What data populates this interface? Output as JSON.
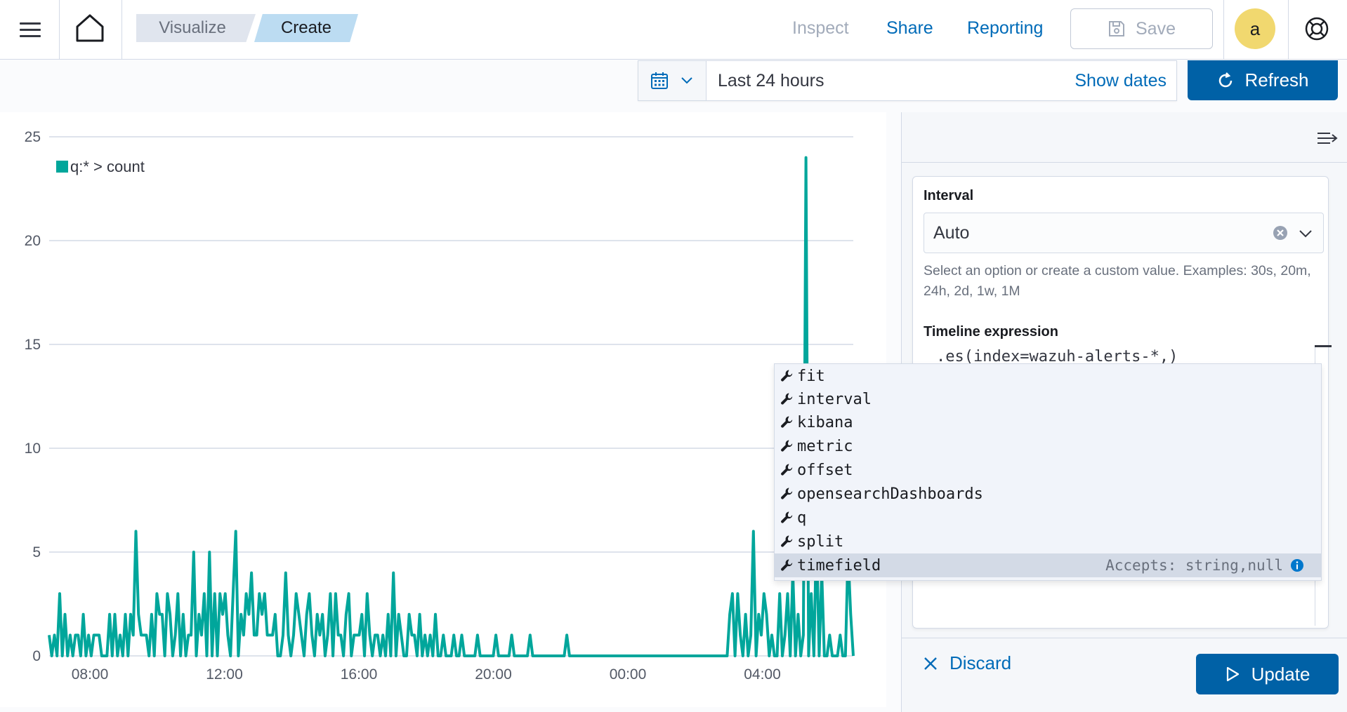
{
  "topbar": {
    "breadcrumbs": [
      "Visualize",
      "Create"
    ],
    "inspect_label": "Inspect",
    "share_label": "Share",
    "reporting_label": "Reporting",
    "save_label": "Save",
    "avatar_initial": "a"
  },
  "querybar": {
    "range_label": "Last 24 hours",
    "show_dates_label": "Show dates",
    "refresh_label": "Refresh"
  },
  "chart_data": {
    "type": "line",
    "legend": [
      "q:* > count"
    ],
    "color": "#00a69b",
    "y_ticks": [
      "0",
      "5",
      "10",
      "15",
      "20",
      "25"
    ],
    "x_ticks": [
      "08:00",
      "12:00",
      "16:00",
      "20:00",
      "00:00",
      "04:00"
    ],
    "ylim": [
      0,
      25
    ],
    "grid": true,
    "legend_position": "top-left",
    "series": [
      {
        "name": "q:* > count",
        "values": [
          1,
          0,
          1,
          0,
          3,
          0,
          2,
          0,
          1,
          0,
          1,
          1,
          0,
          2,
          0,
          1,
          0,
          1,
          1,
          1,
          0,
          0,
          0,
          2,
          0,
          2,
          0,
          1,
          0,
          2,
          0,
          2,
          1,
          6,
          2,
          1,
          1,
          1,
          0,
          2,
          0,
          3,
          2,
          2,
          0,
          3,
          2,
          0,
          1,
          3,
          0,
          2,
          0,
          1,
          1,
          5,
          0,
          2,
          1,
          3,
          0,
          5,
          0,
          3,
          0,
          3,
          2,
          3,
          1,
          0,
          3,
          6,
          0,
          2,
          1,
          3,
          2,
          4,
          1,
          1,
          3,
          2,
          3,
          1,
          1,
          1,
          2,
          0,
          0,
          1,
          4,
          1,
          0,
          1,
          3,
          2,
          1,
          0,
          2,
          3,
          1,
          0,
          2,
          1,
          2,
          0,
          1,
          3,
          0,
          3,
          1,
          1,
          0,
          2,
          3,
          0,
          1,
          1,
          1,
          2,
          0,
          3,
          1,
          0,
          1,
          1,
          0,
          1,
          0,
          2,
          0,
          4,
          0,
          2,
          1,
          0,
          0,
          2,
          1,
          1,
          0,
          2,
          0,
          1,
          0,
          1,
          0,
          2,
          0,
          0,
          1,
          0,
          0,
          0,
          1,
          0,
          0,
          1,
          0,
          0,
          0,
          0,
          0,
          1,
          0,
          0,
          0,
          0,
          0,
          0,
          1,
          0,
          0,
          0,
          0,
          0,
          1,
          0,
          0,
          0,
          0,
          0,
          0,
          1,
          0,
          0,
          0,
          0,
          0,
          0,
          0,
          0,
          0,
          0,
          0,
          0,
          0,
          1,
          0,
          0,
          0,
          0,
          0,
          0,
          0,
          0,
          0,
          0,
          0,
          0,
          0,
          0,
          0,
          0,
          0,
          0,
          0,
          0,
          0,
          0,
          0,
          0,
          0,
          0,
          0,
          0,
          0,
          0,
          0,
          0,
          0,
          0,
          0,
          0,
          0,
          0,
          0,
          0,
          0,
          0,
          0,
          0,
          0,
          0,
          0,
          0,
          0,
          0,
          0,
          0,
          0,
          0,
          0,
          0,
          0,
          0,
          0,
          0,
          0,
          2,
          3,
          0,
          3,
          1,
          0,
          2,
          0,
          1,
          6,
          0,
          2,
          1,
          3,
          2,
          0,
          1,
          0,
          0,
          3,
          0,
          1,
          3,
          0,
          4,
          0,
          2,
          0,
          1,
          24,
          0,
          3,
          0,
          6,
          0,
          4,
          0,
          0,
          1,
          0,
          0,
          0,
          1,
          0,
          0,
          5,
          2,
          0
        ]
      }
    ]
  },
  "side_panel": {
    "interval_label": "Interval",
    "interval_value": "Auto",
    "interval_help": "Select an option or create a custom value. Examples: 30s, 20m, 24h, 2d, 1w, 1M",
    "timeline_label": "Timeline expression",
    "expression": ".es(index=wazuh-alerts-*,)",
    "discard_label": "Discard",
    "update_label": "Update"
  },
  "suggestions": {
    "items": [
      "fit",
      "interval",
      "kibana",
      "metric",
      "offset",
      "opensearchDashboards",
      "q",
      "split",
      "timefield"
    ],
    "accepts_label": "Accepts: string,null"
  }
}
